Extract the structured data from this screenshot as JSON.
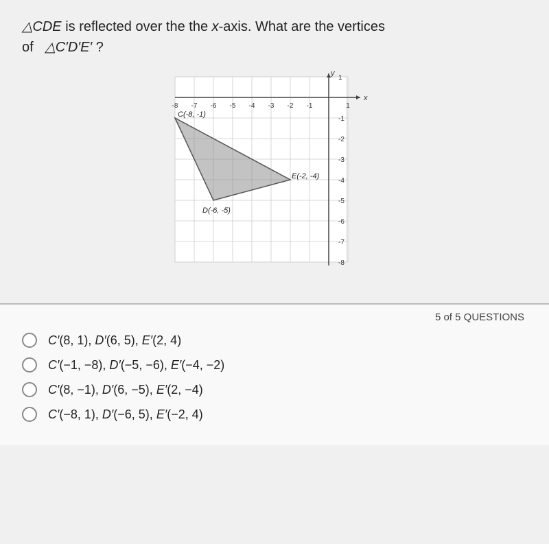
{
  "question": {
    "prefix": "△CDE",
    "text_part1": " is reflected over the ",
    "axis": "x",
    "text_part2": "-axis. What are the vertices of ",
    "prefix2": "△C′D′E′",
    "text_part3": "?"
  },
  "question_count": "5 of 5 QUESTIONS",
  "graph": {
    "x_labels": [
      "-8",
      "-7",
      "-6",
      "-5",
      "-4",
      "-3",
      "-2",
      "-1",
      "1"
    ],
    "y_labels": [
      "1",
      "-1",
      "-2",
      "-3",
      "-4",
      "-5",
      "-6",
      "-7",
      "-8"
    ],
    "vertex_C": "C(-8, -1)",
    "vertex_D": "D(-6, -5)",
    "vertex_E": "E(-2, -4)"
  },
  "answers": [
    {
      "id": "a",
      "text": "C′(8, 1), D′(6, 5), E′(2, 4)"
    },
    {
      "id": "b",
      "text": "C′(−1, −8), D′(−5, −6), E′(−4, −2)"
    },
    {
      "id": "c",
      "text": "C′(8, −1), D′(6, −5), E′(2, −4)"
    },
    {
      "id": "d",
      "text": "C′(−8, 1), D′(−6, 5), E′(−2, 4)"
    }
  ]
}
